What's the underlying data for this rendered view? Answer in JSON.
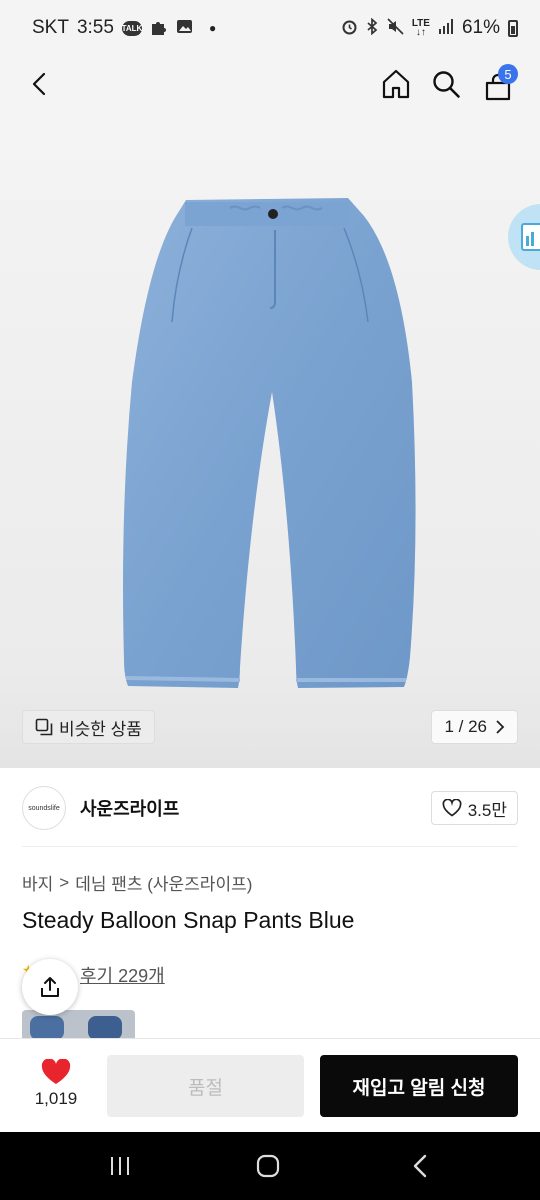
{
  "status_bar": {
    "carrier": "SKT",
    "time": "3:55",
    "talk_badge": "TALK",
    "network": "LTE",
    "battery": "61%"
  },
  "nav": {
    "cart_count": "5"
  },
  "gallery": {
    "similar_label": "비슷한 상품",
    "counter": "1 / 26",
    "image_alt": "Steady Balloon Snap Pants Blue - light blue denim balloon pants"
  },
  "brand": {
    "logo_text": "soundslife",
    "name": "사운즈라이프",
    "likes": "3.5만"
  },
  "product": {
    "breadcrumb": [
      "바지",
      "데님 팬츠 (사운즈라이프)"
    ],
    "breadcrumb_sep": ">",
    "title": "Steady Balloon Snap Pants Blue",
    "reviews": "후기 229개"
  },
  "bottom_bar": {
    "wish_count": "1,019",
    "soldout_label": "품절",
    "restock_label": "재입고 알림 신청"
  },
  "colors": {
    "accent_blue": "#3a73ec",
    "heart_red": "#e8242c",
    "denim": "#7fa6d2",
    "black_button": "#0a0a0a"
  }
}
